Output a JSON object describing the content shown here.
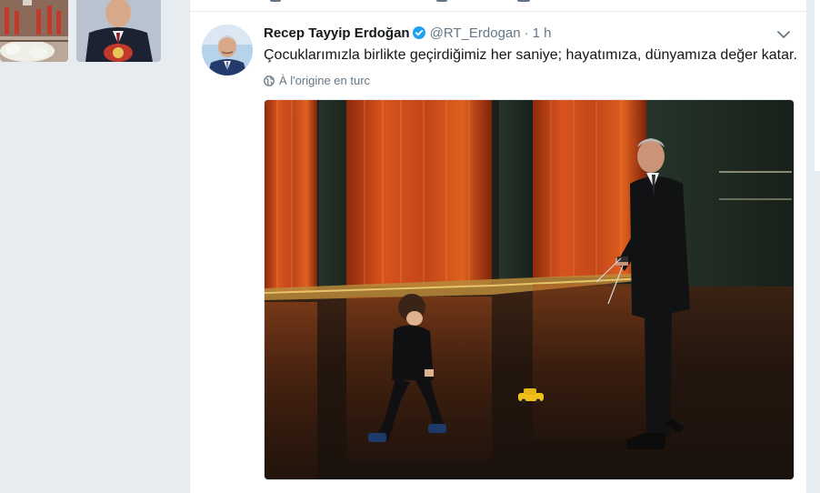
{
  "tweet": {
    "fullname": "Recep Tayyip Erdoğan",
    "username": "@RT_Erdogan",
    "separator": "·",
    "timestamp": "1 h",
    "text": "Çocuklarımızla birlikte geçirdiğimiz her saniye; hayatımıza, dünyamıza değer katar.",
    "translate_label": "À l'origine en turc"
  },
  "icons": {
    "verified": "verified-badge-icon",
    "caret": "chevron-down-icon",
    "translate": "globe-icon"
  },
  "colors": {
    "verified_badge": "#1da1f2",
    "background": "#e6ecf0",
    "secondary_text": "#657786"
  }
}
